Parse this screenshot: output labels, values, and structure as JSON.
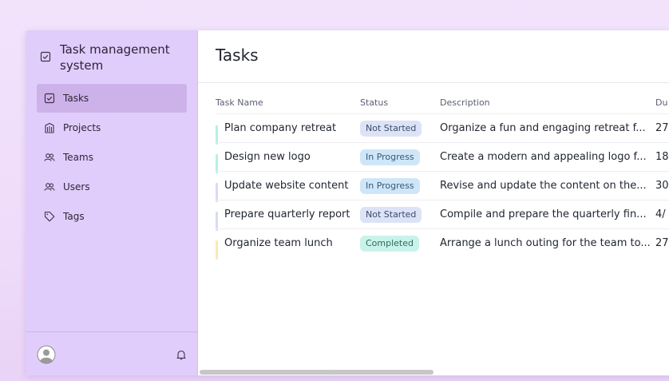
{
  "app": {
    "title": "Task management system"
  },
  "sidebar": {
    "items": [
      {
        "label": "Tasks",
        "icon": "checkbox-icon",
        "active": true
      },
      {
        "label": "Projects",
        "icon": "building-icon",
        "active": false
      },
      {
        "label": "Teams",
        "icon": "users-icon",
        "active": false
      },
      {
        "label": "Users",
        "icon": "users-icon",
        "active": false
      },
      {
        "label": "Tags",
        "icon": "tag-icon",
        "active": false
      }
    ]
  },
  "page": {
    "title": "Tasks"
  },
  "table": {
    "columns": {
      "name": "Task Name",
      "status": "Status",
      "description": "Description",
      "due": "Du"
    },
    "rows": [
      {
        "name": "Plan company retreat",
        "status": "Not Started",
        "description": "Organize a fun and engaging retreat f...",
        "due": "27"
      },
      {
        "name": "Design new logo",
        "status": "In Progress",
        "description": "Create a modern and appealing logo f...",
        "due": "18"
      },
      {
        "name": "Update website content",
        "status": "In Progress",
        "description": "Revise and update the content on the...",
        "due": "30"
      },
      {
        "name": "Prepare quarterly report",
        "status": "Not Started",
        "description": "Compile and prepare the quarterly fin...",
        "due": "4/"
      },
      {
        "name": "Organize team lunch",
        "status": "Completed",
        "description": "Arrange a lunch outing for the team to...",
        "due": "27"
      }
    ]
  },
  "colors": {
    "sidebar_bg": "#e1cdfc",
    "active_item_bg": "#cdb2ea",
    "not_started_badge": "#dde3f7",
    "in_progress_badge": "#cfe6f8",
    "completed_badge": "#c9f3ea",
    "stripe_not_started": "#b6f0e4",
    "stripe_in_progress": "#d8dcf4",
    "stripe_completed": "#f8eab0"
  }
}
